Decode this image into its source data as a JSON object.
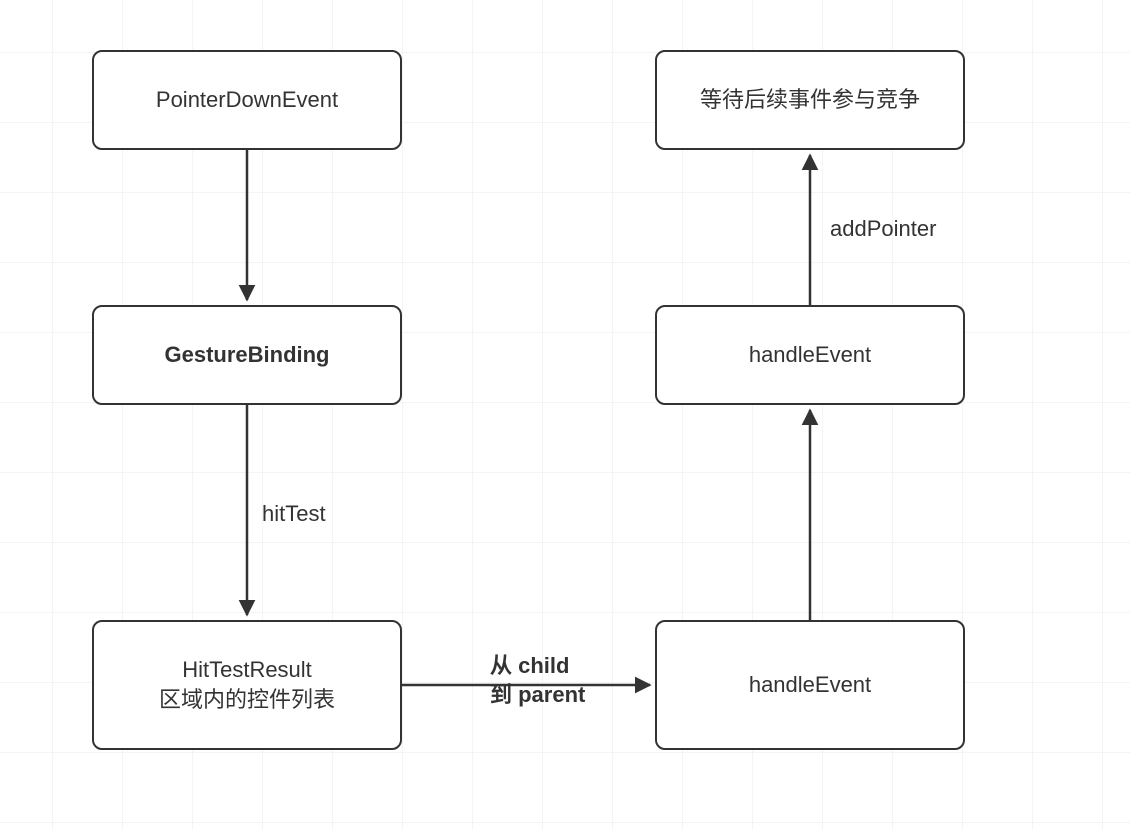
{
  "nodes": {
    "pointerDown": {
      "label": "PointerDownEvent",
      "bold": false
    },
    "gestureBinding": {
      "label": "GestureBinding",
      "bold": true
    },
    "hitTestResult": {
      "line1": "HitTestResult",
      "line2": "区域内的控件列表",
      "bold": false
    },
    "handleEvent1": {
      "label": "handleEvent",
      "bold": false
    },
    "handleEvent2": {
      "label": "handleEvent",
      "bold": false
    },
    "waitCompete": {
      "label": "等待后续事件参与竞争",
      "bold": false
    }
  },
  "edges": {
    "hitTest": {
      "label": "hitTest"
    },
    "childParent": {
      "line1": "从 child",
      "line2": "到 parent"
    },
    "addPointer": {
      "label": "addPointer"
    }
  },
  "colors": {
    "stroke": "#333333",
    "grid": "#f2f4f7",
    "bg": "#ffffff"
  }
}
